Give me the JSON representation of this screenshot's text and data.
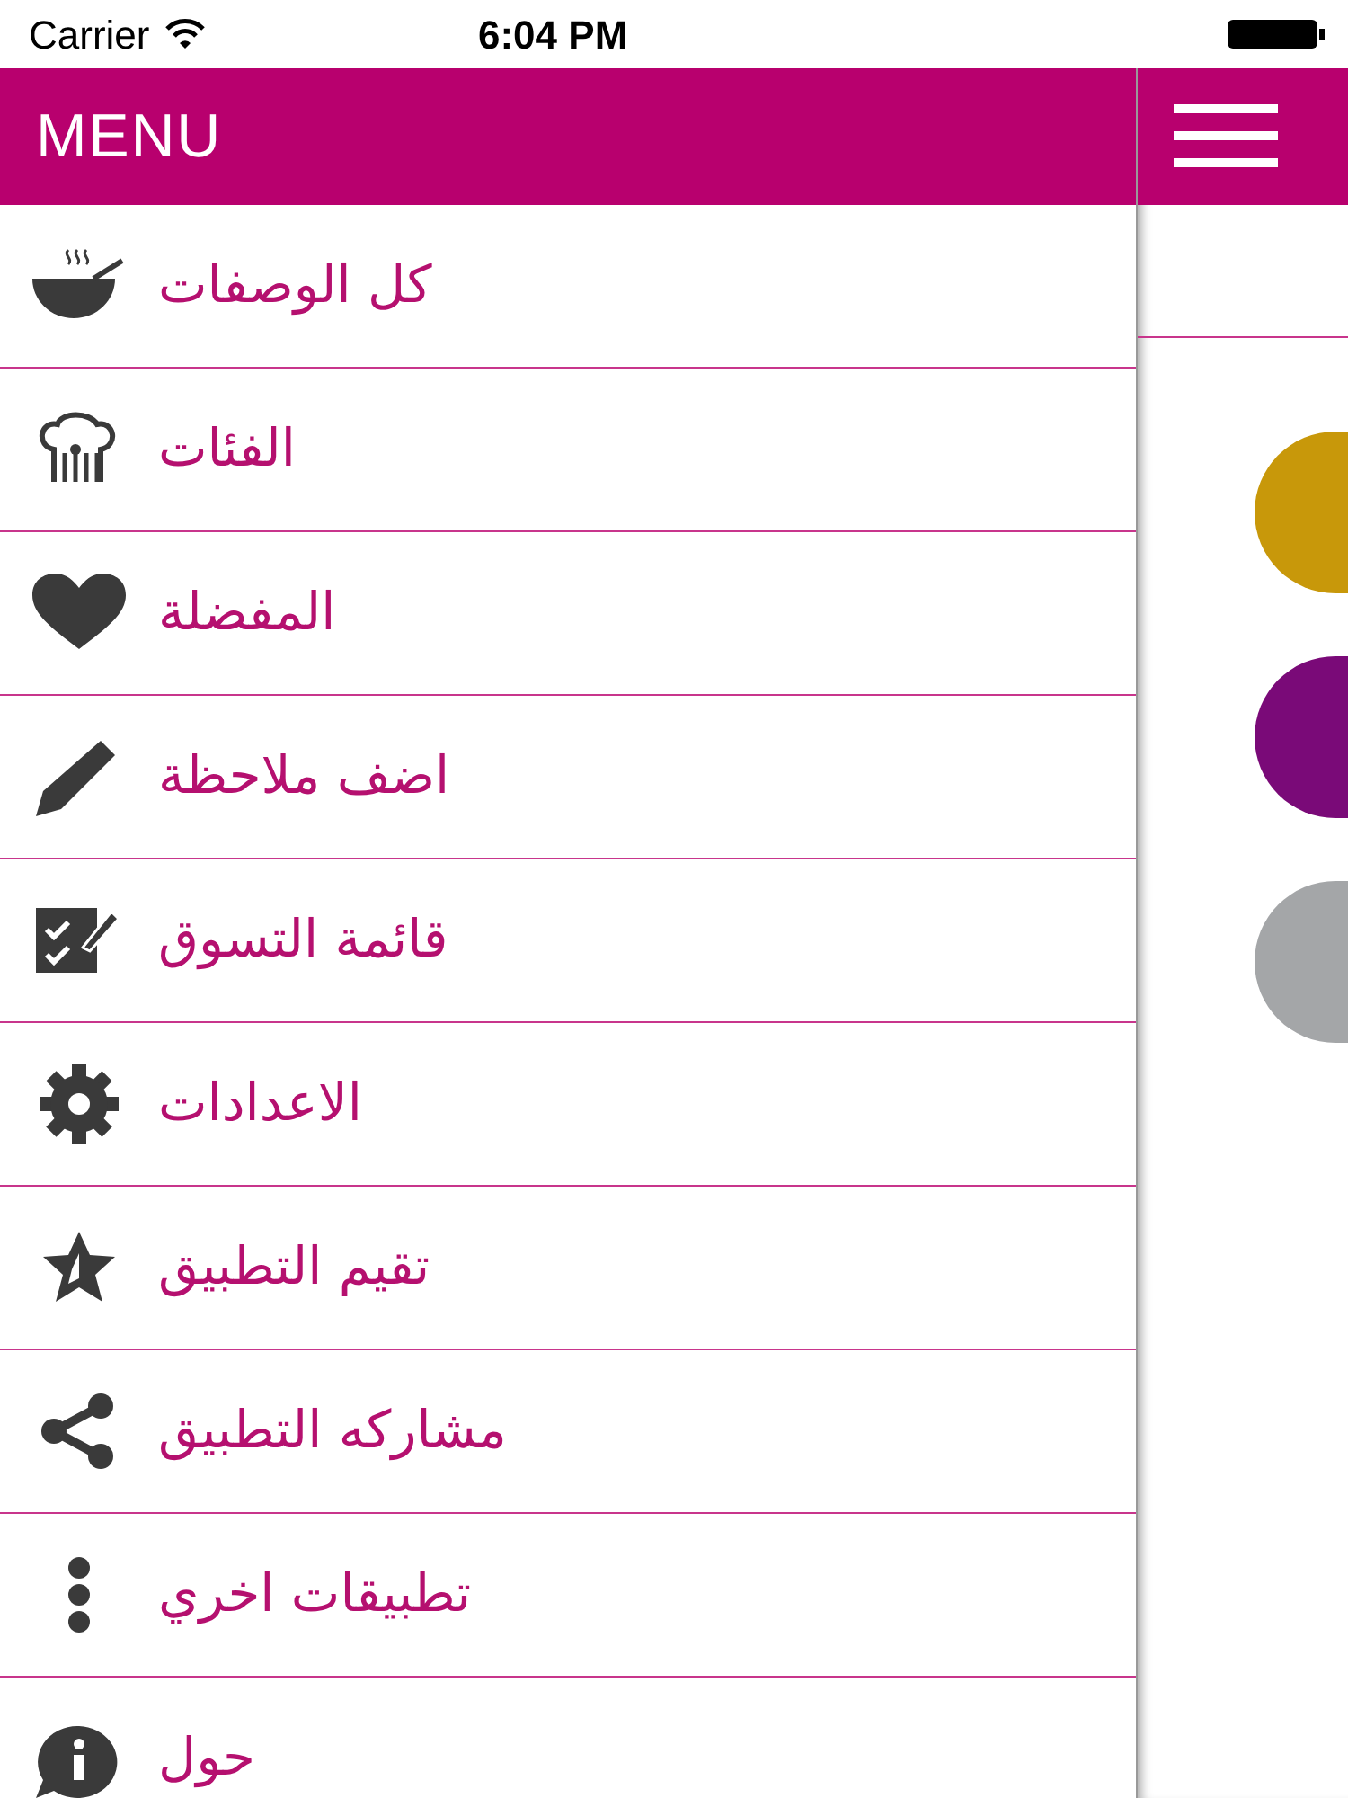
{
  "status_bar": {
    "carrier": "Carrier",
    "time": "6:04 PM"
  },
  "menu": {
    "title": "MENU",
    "items": [
      {
        "label": "كل الوصفات"
      },
      {
        "label": "الفئات"
      },
      {
        "label": "المفضلة"
      },
      {
        "label": "اضف ملاحظة"
      },
      {
        "label": "قائمة التسوق"
      },
      {
        "label": "الاعدادات"
      },
      {
        "label": "تقيم التطبيق"
      },
      {
        "label": "مشاركه التطبيق"
      },
      {
        "label": "تطبيقات اخري"
      },
      {
        "label": "حول"
      }
    ]
  },
  "background_screen": {
    "circles": [
      {
        "color": "#c8980a"
      },
      {
        "color": "#7a0a78"
      },
      {
        "color": "#a4a6a8"
      }
    ]
  }
}
